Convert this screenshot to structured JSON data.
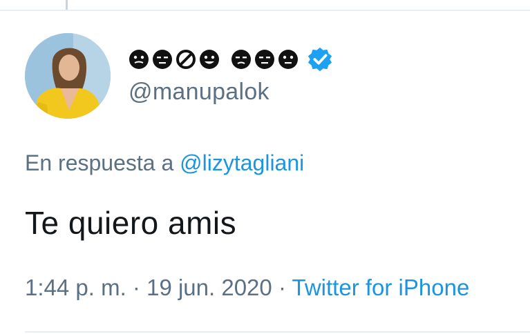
{
  "tweet": {
    "display_name_emojis": [
      "dark-face-emoji",
      "dark-face-emoji",
      "prohibited-emoji",
      "dark-face-emoji",
      "dark-face-emoji",
      "dark-face-emoji",
      "dark-face-emoji"
    ],
    "verified": true,
    "handle": "@manupalok",
    "reply_prefix": "En respuesta a",
    "reply_to": "@lizytagliani",
    "text": "Te quiero amis",
    "time": "1:44 p. m.",
    "separator": "·",
    "date": "19 jun. 2020",
    "source": "Twitter for iPhone"
  },
  "colors": {
    "secondary_text": "#5b7083",
    "link": "#1b95e0",
    "primary_text": "#14171a",
    "verified_badge": "#1da1f2"
  }
}
